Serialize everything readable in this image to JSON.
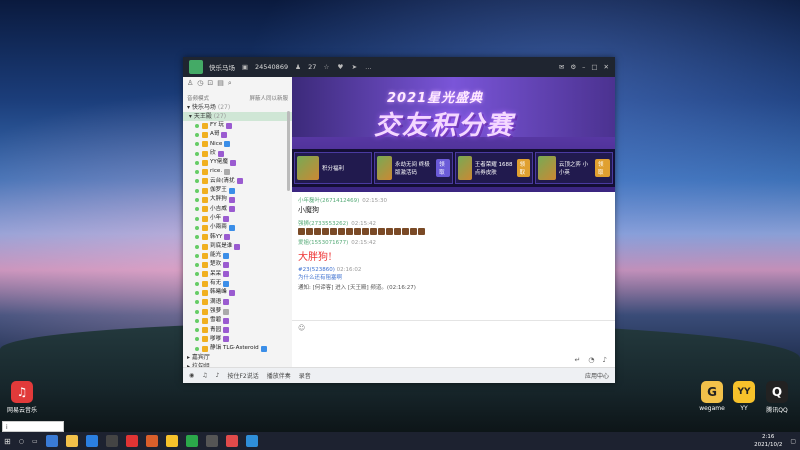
{
  "desktop": {
    "icons": [
      {
        "label": "网易云音乐",
        "glyph": "♫"
      },
      {
        "label": "wegame",
        "glyph": "G"
      },
      {
        "label": "YY",
        "glyph": "YY"
      },
      {
        "label": "腾讯QQ",
        "glyph": "Q"
      }
    ],
    "search_text": "i"
  },
  "window": {
    "title": "快乐马场",
    "room_id": "24540869",
    "online": "27",
    "left": {
      "header_left": "音频模式",
      "header_right": "屏蔽人同以新服",
      "channels": [
        "快乐马场",
        "天王殿"
      ],
      "channel_counts": [
        "(27)",
        "(27)"
      ],
      "members": [
        "FY 玩",
        "A哥",
        "Nice",
        "欣",
        "YY佬魔",
        "rice.",
        "云台(清扰",
        "伽罗王",
        "大胖狗",
        "小吉威",
        "小年",
        "小兩兩",
        "韩YY",
        "到底是谁",
        "能光",
        "楚欢",
        "呆呆",
        "有无",
        "韩曦峰",
        "满语",
        "强萝",
        "雪碧",
        "青园",
        "嗲嗲",
        "静诣 TLG·Asteroid"
      ],
      "groups": [
        "嘉宾厅",
        "拉勾组"
      ]
    },
    "banner": {
      "title_top": "2021星光盛典",
      "title_main": "交友积分赛",
      "cards": [
        {
          "title": "积分福利",
          "btn": ""
        },
        {
          "title": "永劫无间 终极版激活码",
          "btn": "领取"
        },
        {
          "title": "王者荣耀 1688点券皮肤",
          "btn": "领取"
        },
        {
          "title": "云顶之弈 小小英",
          "btn": "领取"
        }
      ]
    },
    "chat": {
      "messages": [
        {
          "user": "小年磊叶(2671412469)",
          "time": "02:15:30",
          "text": "小魔狗"
        },
        {
          "user": "强狮(2733553262)",
          "time": "02:15:42",
          "text": ""
        },
        {
          "user": "爱姐(1553071677)",
          "time": "02:15:42",
          "text": "大胖狗!"
        }
      ],
      "sys_line": "#23(523860)",
      "sys_time": "02:16:02",
      "sys_sub": "为什么还有阻塞啊",
      "notice": "通知: [何谛客] 进入 [天王殿] 频道。(02:16:27)"
    },
    "input": {
      "placeholder": ""
    },
    "bottom": {
      "items": [
        "按住F2说话",
        "播放伴奏",
        "录音"
      ],
      "right": "应用中心"
    }
  },
  "taskbar": {
    "time": "2:16",
    "date": "2021/10/2"
  }
}
